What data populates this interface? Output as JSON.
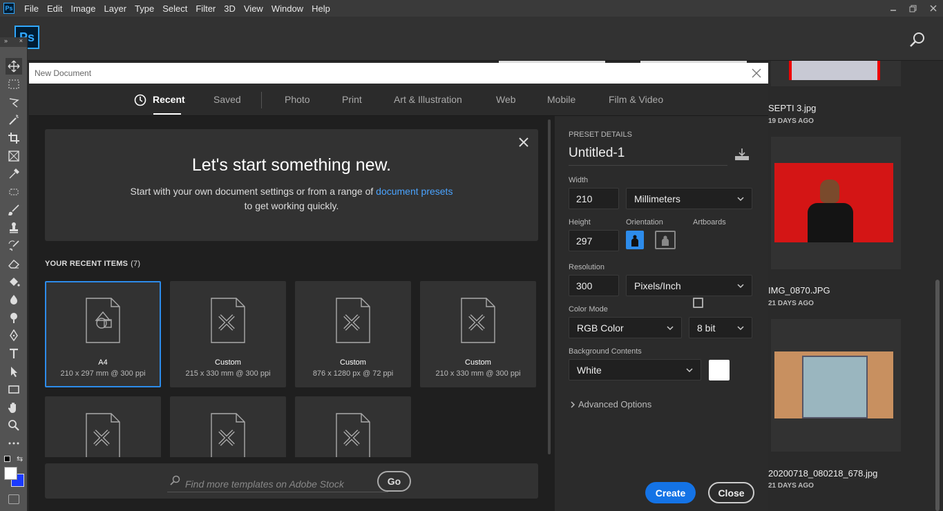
{
  "menubar": {
    "app_badge": "Ps",
    "items": [
      "File",
      "Edit",
      "Image",
      "Layer",
      "Type",
      "Select",
      "Filter",
      "3D",
      "View",
      "Window",
      "Help"
    ]
  },
  "optionsbar": {
    "logo": "Ps"
  },
  "dialog": {
    "title": "New Document",
    "tabs": [
      "Recent",
      "Saved",
      "Photo",
      "Print",
      "Art & Illustration",
      "Web",
      "Mobile",
      "Film & Video"
    ],
    "active_tab": "Recent",
    "welcome": {
      "heading": "Let's start something new.",
      "line1_prefix": "Start with your own document settings or from a range of ",
      "line1_link": "document presets",
      "line2": "to get working quickly."
    },
    "recent_label": "YOUR RECENT ITEMS",
    "recent_count": "(7)",
    "recent_items": [
      {
        "name": "A4",
        "spec": "210 x 297 mm @ 300 ppi"
      },
      {
        "name": "Custom",
        "spec": "215 x 330 mm @ 300 ppi"
      },
      {
        "name": "Custom",
        "spec": "876 x 1280 px @ 72 ppi"
      },
      {
        "name": "Custom",
        "spec": "210 x 330 mm @ 300 ppi"
      }
    ],
    "stock": {
      "placeholder": "Find more templates on Adobe Stock",
      "go_label": "Go"
    },
    "preset": {
      "header": "PRESET DETAILS",
      "name": "Untitled-1",
      "width_label": "Width",
      "width_value": "210",
      "width_unit": "Millimeters",
      "height_label": "Height",
      "height_value": "297",
      "orientation_label": "Orientation",
      "artboards_label": "Artboards",
      "resolution_label": "Resolution",
      "resolution_value": "300",
      "resolution_unit": "Pixels/Inch",
      "color_mode_label": "Color Mode",
      "color_mode": "RGB Color",
      "bit_depth": "8 bit",
      "bg_label": "Background Contents",
      "bg_value": "White",
      "advanced": "Advanced Options",
      "create_label": "Create",
      "close_label": "Close"
    }
  },
  "recent_files": [
    {
      "name": "SEPTI 3.jpg",
      "age": "19 DAYS AGO"
    },
    {
      "name": "IMG_0870.JPG",
      "age": "21 DAYS AGO"
    },
    {
      "name": "20200718_080218_678.jpg",
      "age": "21 DAYS AGO"
    }
  ],
  "colors": {
    "accent": "#1473e6",
    "link": "#4aa3ff",
    "ps_blue": "#31a8ff"
  }
}
